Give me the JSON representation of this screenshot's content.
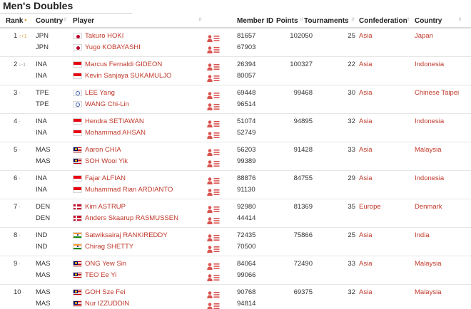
{
  "page_title": "Men's Doubles",
  "columns": {
    "rank": "Rank",
    "country": "Country",
    "player": "Player",
    "member_id": "Member ID",
    "points": "Points",
    "tournaments": "Tournaments",
    "confederation": "Confederation",
    "country_name": "Country"
  },
  "rows": [
    {
      "rank": "1",
      "change": "+1",
      "change_dir": "up",
      "players": [
        {
          "code": "JPN",
          "name": "Takuro HOKI",
          "member_id": "81657",
          "flag": "jpn"
        },
        {
          "code": "JPN",
          "name": "Yugo KOBAYASHI",
          "member_id": "67903",
          "flag": "jpn"
        }
      ],
      "points": "102050",
      "tournaments": "25",
      "confederation": "Asia",
      "country": "Japan"
    },
    {
      "rank": "2",
      "change": "-1",
      "change_dir": "down",
      "players": [
        {
          "code": "INA",
          "name": "Marcus Fernaldi GIDEON",
          "member_id": "26394",
          "flag": "ina"
        },
        {
          "code": "INA",
          "name": "Kevin Sanjaya SUKAMULJO",
          "member_id": "80057",
          "flag": "ina"
        }
      ],
      "points": "100327",
      "tournaments": "22",
      "confederation": "Asia",
      "country": "Indonesia"
    },
    {
      "rank": "3",
      "change": "-",
      "change_dir": "same",
      "players": [
        {
          "code": "TPE",
          "name": "LEE Yang",
          "member_id": "69448",
          "flag": "tpe"
        },
        {
          "code": "TPE",
          "name": "WANG Chi-Lin",
          "member_id": "96514",
          "flag": "tpe"
        }
      ],
      "points": "99468",
      "tournaments": "30",
      "confederation": "Asia",
      "country": "Chinese Taipei"
    },
    {
      "rank": "4",
      "change": "-",
      "change_dir": "same",
      "players": [
        {
          "code": "INA",
          "name": "Hendra SETIAWAN",
          "member_id": "51074",
          "flag": "ina"
        },
        {
          "code": "INA",
          "name": "Mohammad AHSAN",
          "member_id": "52749",
          "flag": "ina"
        }
      ],
      "points": "94895",
      "tournaments": "32",
      "confederation": "Asia",
      "country": "Indonesia"
    },
    {
      "rank": "5",
      "change": "-",
      "change_dir": "same",
      "players": [
        {
          "code": "MAS",
          "name": "Aaron CHIA",
          "member_id": "56203",
          "flag": "mas"
        },
        {
          "code": "MAS",
          "name": "SOH Wooi Yik",
          "member_id": "99389",
          "flag": "mas"
        }
      ],
      "points": "91428",
      "tournaments": "33",
      "confederation": "Asia",
      "country": "Malaysia"
    },
    {
      "rank": "6",
      "change": "-",
      "change_dir": "same",
      "players": [
        {
          "code": "INA",
          "name": "Fajar ALFIAN",
          "member_id": "88876",
          "flag": "ina"
        },
        {
          "code": "INA",
          "name": "Muhammad Rian ARDIANTO",
          "member_id": "91130",
          "flag": "ina"
        }
      ],
      "points": "84755",
      "tournaments": "29",
      "confederation": "Asia",
      "country": "Indonesia"
    },
    {
      "rank": "7",
      "change": "-",
      "change_dir": "same",
      "players": [
        {
          "code": "DEN",
          "name": "Kim ASTRUP",
          "member_id": "92980",
          "flag": "den"
        },
        {
          "code": "DEN",
          "name": "Anders Skaarup RASMUSSEN",
          "member_id": "44414",
          "flag": "den"
        }
      ],
      "points": "81369",
      "tournaments": "35",
      "confederation": "Europe",
      "country": "Denmark"
    },
    {
      "rank": "8",
      "change": "-",
      "change_dir": "same",
      "players": [
        {
          "code": "IND",
          "name": "Satwiksairaj RANKIREDDY",
          "member_id": "72435",
          "flag": "ind"
        },
        {
          "code": "IND",
          "name": "Chirag SHETTY",
          "member_id": "70500",
          "flag": "ind"
        }
      ],
      "points": "75866",
      "tournaments": "25",
      "confederation": "Asia",
      "country": "India"
    },
    {
      "rank": "9",
      "change": "-",
      "change_dir": "same",
      "players": [
        {
          "code": "MAS",
          "name": "ONG Yew Sin",
          "member_id": "84064",
          "flag": "mas"
        },
        {
          "code": "MAS",
          "name": "TEO Ee Yi",
          "member_id": "99066",
          "flag": "mas"
        }
      ],
      "points": "72490",
      "tournaments": "33",
      "confederation": "Asia",
      "country": "Malaysia"
    },
    {
      "rank": "10",
      "change": "-",
      "change_dir": "same",
      "players": [
        {
          "code": "MAS",
          "name": "GOH Sze Fei",
          "member_id": "90768",
          "flag": "mas"
        },
        {
          "code": "MAS",
          "name": "Nur IZZUDDIN",
          "member_id": "94814",
          "flag": "mas"
        }
      ],
      "points": "69375",
      "tournaments": "32",
      "confederation": "Asia",
      "country": "Malaysia"
    }
  ],
  "colors": {
    "link": "#c0392b",
    "icon": "#d9534f"
  },
  "icons": {
    "profile": "player-profile-icon",
    "sort": "sort-arrows-icon"
  }
}
